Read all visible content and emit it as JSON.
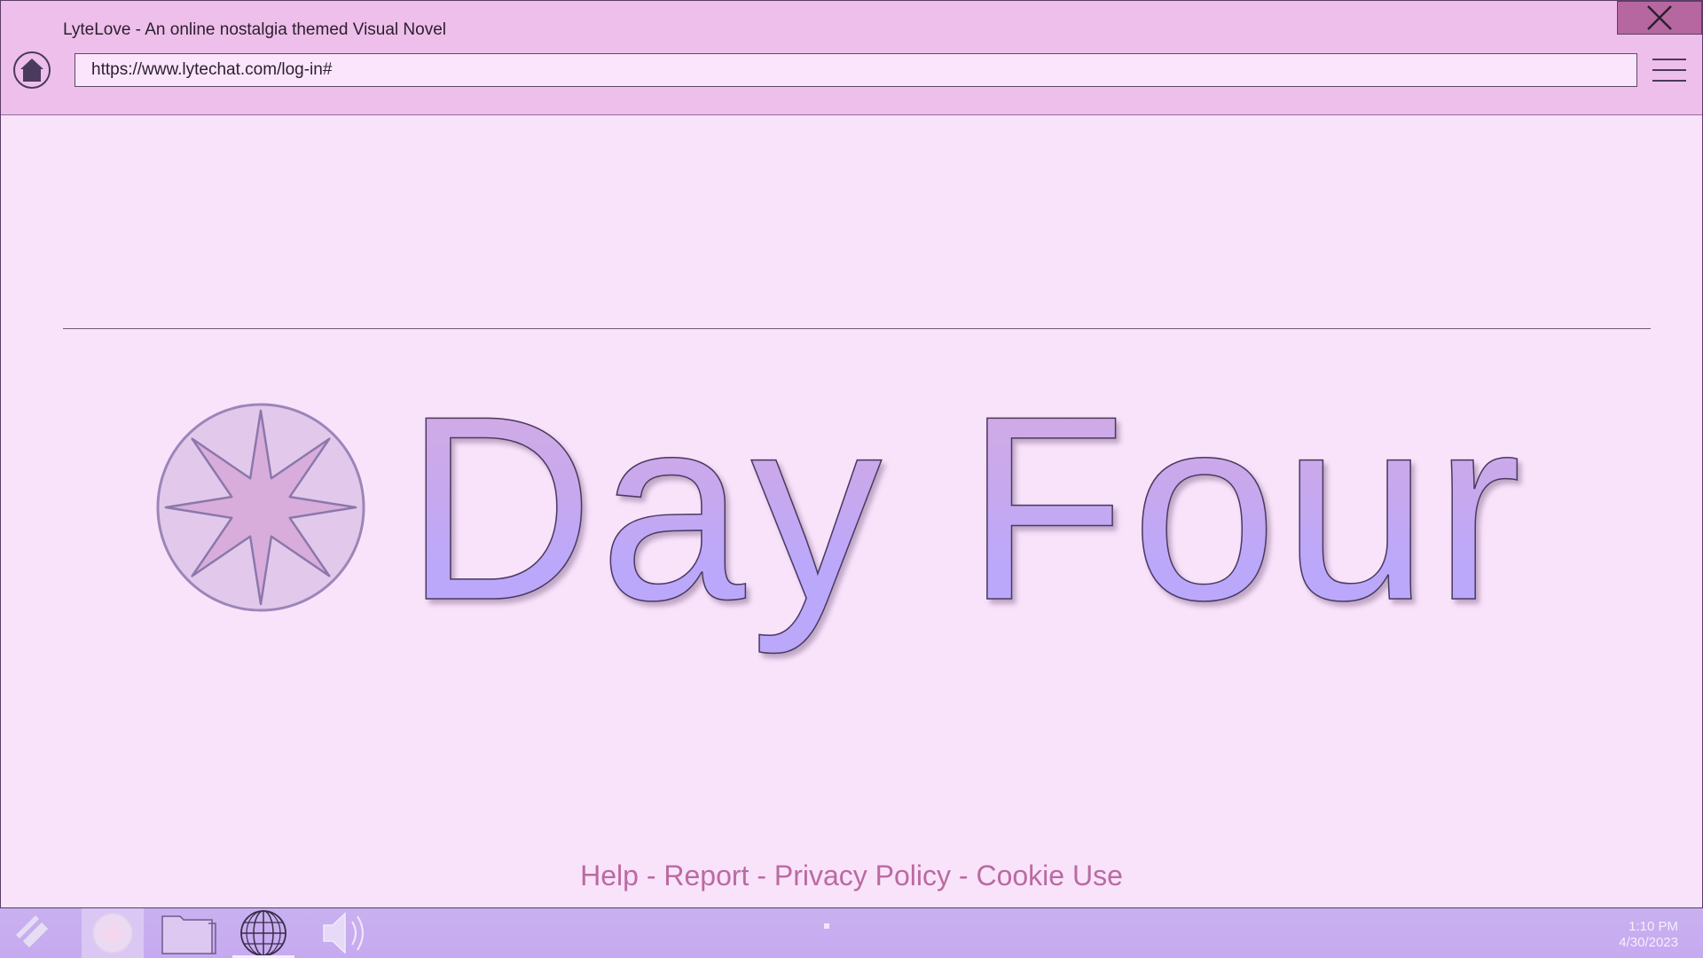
{
  "window": {
    "title": "LyteLove - An online nostalgia themed Visual Novel",
    "url": "https://www.lytechat.com/log-in#"
  },
  "page": {
    "headline": "Day Four",
    "footer_links": [
      "Help",
      "Report",
      "Privacy Policy",
      "Cookie Use"
    ],
    "footer_separator": " - "
  },
  "taskbar": {
    "items": [
      "diamond-app-icon",
      "lytelove-star-app-icon",
      "folder-icon",
      "globe-icon",
      "speaker-icon"
    ],
    "time": "1:10 PM",
    "date": "4/30/2023"
  },
  "colors": {
    "titlebar": "#eebfea",
    "page_background": "#f9e3fb",
    "close_button": "#b7679f",
    "headline_fill": "#bba8fb",
    "footer_link": "#bb6aa2",
    "taskbar": "#c9b1f0"
  }
}
